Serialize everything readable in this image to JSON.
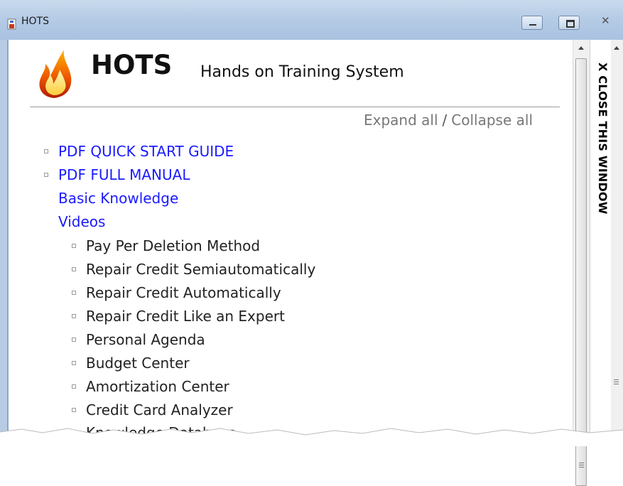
{
  "window": {
    "title": "HOTS",
    "close_glyph": "✕",
    "colors": {
      "titlebar": "#b6cce6",
      "link": "#1a1aff"
    }
  },
  "header": {
    "app_name": "HOTS",
    "subtitle": "Hands on Training System",
    "logo_icon": "flame-icon"
  },
  "controls": {
    "expand_all": "Expand all",
    "separator": "/",
    "collapse_all": "Collapse all"
  },
  "top_links": [
    {
      "label": "PDF QUICK START GUIDE",
      "bullet": true
    },
    {
      "label": "PDF FULL MANUAL",
      "bullet": true
    },
    {
      "label": "Basic Knowledge",
      "bullet": false
    },
    {
      "label": "Videos",
      "bullet": false
    }
  ],
  "videos": [
    "Pay Per Deletion Method",
    "Repair Credit Semiautomatically",
    "Repair Credit Automatically",
    "Repair Credit Like an Expert",
    "Personal Agenda",
    "Budget Center",
    "Amortization Center",
    "Credit Card Analyzer",
    "Knowledge Database"
  ],
  "close_panel": {
    "label": "X CLOSE  THIS WINDOW"
  }
}
